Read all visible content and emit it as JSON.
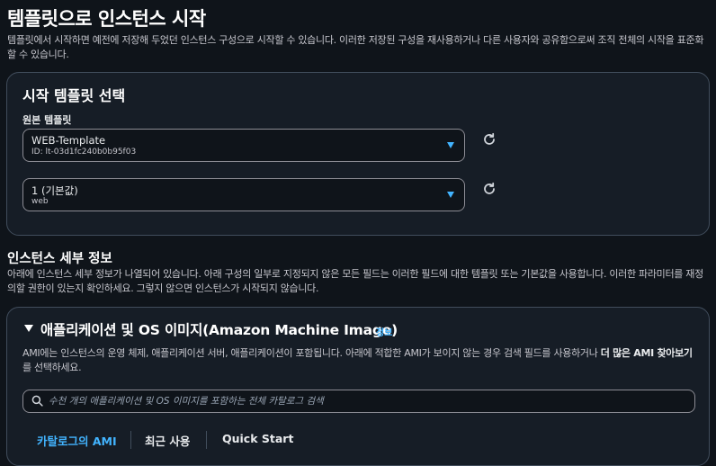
{
  "page": {
    "title": "템플릿으로 인스턴스 시작",
    "description": "템플릿에서 시작하면 예전에 저장해 두었던 인스턴스 구성으로 시작할 수 있습니다. 이러한 저장된 구성을 재사용하거나 다른 사용자와 공유함으로써 조직 전체의 시작을 표준화할 수 있습니다."
  },
  "template_card": {
    "title": "시작 템플릿 선택",
    "source_label": "원본 템플릿",
    "template_select": {
      "value": "WEB-Template",
      "sub": "ID: lt-03d1fc240b0b95f03"
    },
    "version_select": {
      "value": "1 (기본값)",
      "sub": "web"
    }
  },
  "details": {
    "title": "인스턴스 세부 정보",
    "description": "아래에 인스턴스 세부 정보가 나열되어 있습니다. 아래 구성의 일부로 지정되지 않은 모든 필드는 이러한 필드에 대한 템플릿 또는 기본값을 사용합니다. 이러한 파라미터를 재정의할 권한이 있는지 확인하세요. 그렇지 않으면 인스턴스가 시작되지 않습니다."
  },
  "ami_card": {
    "title": "애플리케이션 및 OS 이미지(Amazon Machine Image)",
    "info_link": "정보",
    "desc_pre": "AMI에는 인스턴스의 운영 체제, 애플리케이션 서버, 애플리케이션이 포함됩니다. 아래에 적합한 AMI가 보이지 않는 경우 검색 필드를 사용하거나 ",
    "desc_bold": "더 많은 AMI 찾아보기",
    "desc_post": "를 선택하세요.",
    "search_placeholder": "수천 개의 애플리케이션 및 OS 이미지를 포함하는 전체 카탈로그 검색",
    "tabs": [
      "카탈로그의 AMI",
      "최근 사용",
      "Quick Start"
    ],
    "active_tab": 0
  },
  "colors": {
    "accent": "#42b4ff",
    "background": "#0f141a",
    "card": "#161d26",
    "border": "#414d5c"
  },
  "icons": {
    "refresh": "refresh-icon",
    "dropdown": "caret-down-icon",
    "search": "search-icon",
    "expand": "expand-triangle-icon"
  }
}
